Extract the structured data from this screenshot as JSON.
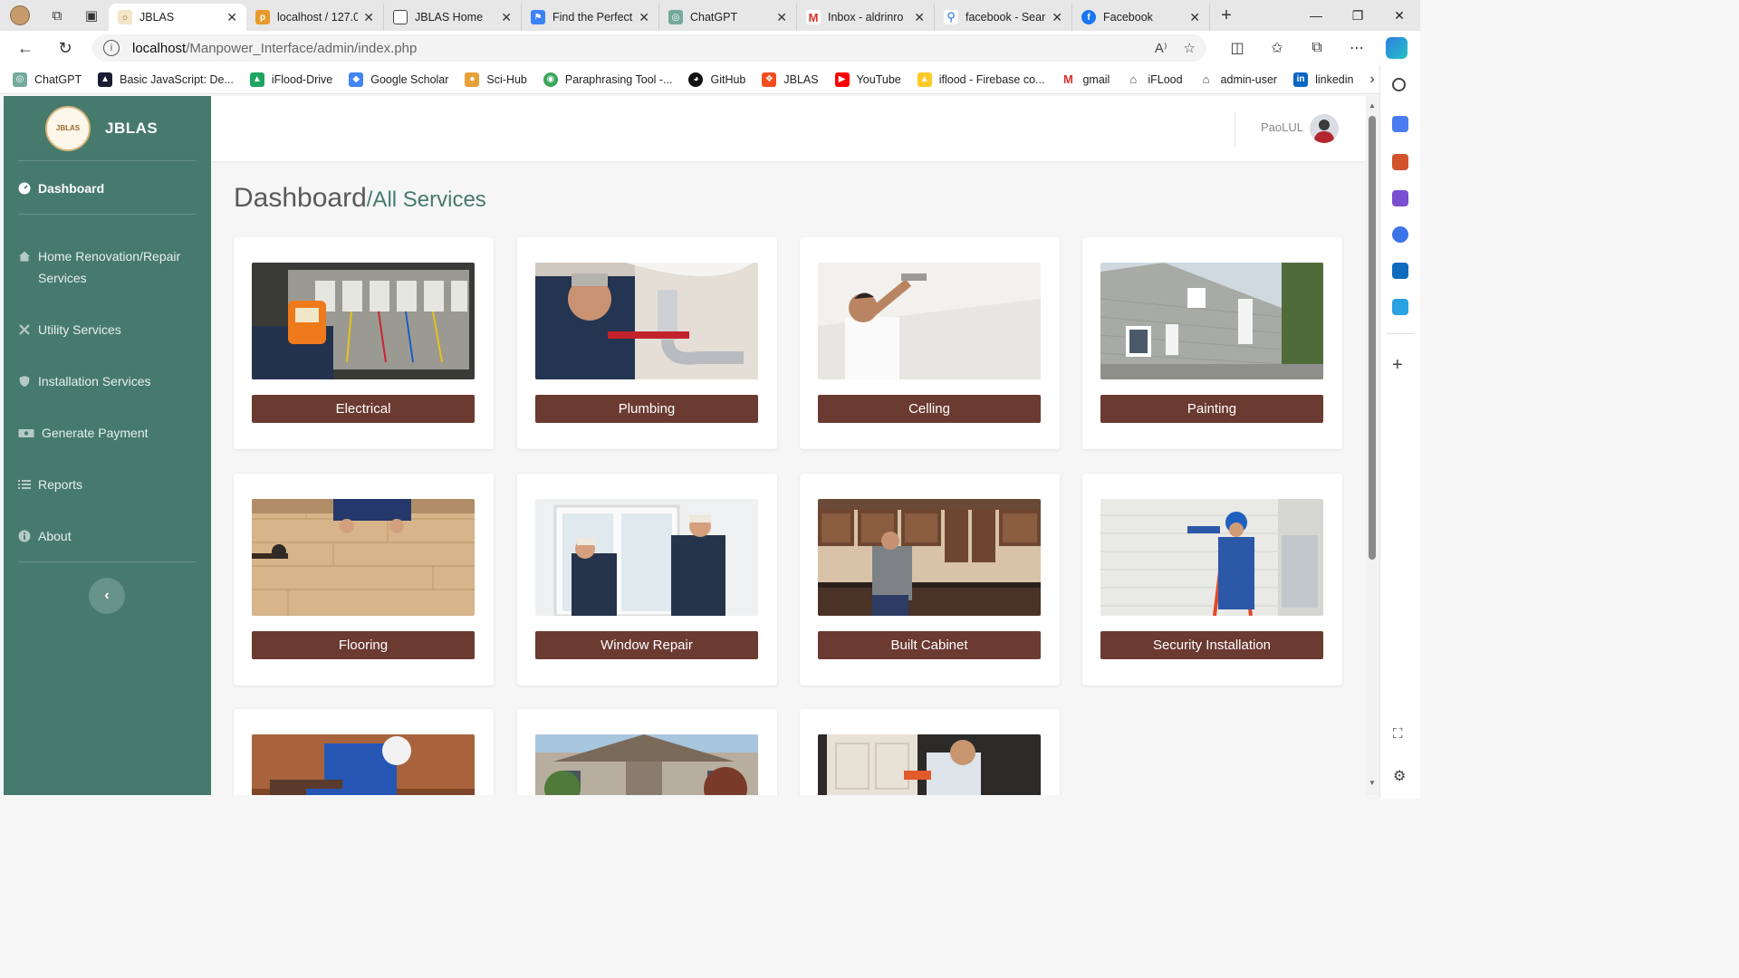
{
  "browser": {
    "tabs": [
      {
        "label": "JBLAS",
        "active": true
      },
      {
        "label": "localhost / 127.0",
        "active": false
      },
      {
        "label": "JBLAS Home",
        "active": false
      },
      {
        "label": "Find the Perfect",
        "active": false
      },
      {
        "label": "ChatGPT",
        "active": false
      },
      {
        "label": "Inbox - aldrinro",
        "active": false
      },
      {
        "label": "facebook - Searc",
        "active": false
      },
      {
        "label": "Facebook",
        "active": false
      }
    ],
    "url_host": "localhost",
    "url_path": "/Manpower_Interface/admin/index.php",
    "bookmarks": [
      "ChatGPT",
      "Basic JavaScript: De...",
      "iFlood-Drive",
      "Google Scholar",
      "Sci-Hub",
      "Paraphrasing Tool -...",
      "GitHub",
      "JBLAS",
      "YouTube",
      "iflood - Firebase co...",
      "gmail",
      "iFLood",
      "admin-user",
      "linkedin"
    ]
  },
  "app": {
    "brand": "JBLAS",
    "logo_text": "JBLAS",
    "user_name": "PaoLUL",
    "page_title": "Dashboard",
    "page_subtitle": "/All Services",
    "nav": [
      {
        "label": "Dashboard",
        "icon": "dashboard-icon",
        "active": true
      },
      {
        "label": "Home Renovation/Repair Services",
        "icon": "home-icon",
        "active": false
      },
      {
        "label": "Utility Services",
        "icon": "tools-icon",
        "active": false
      },
      {
        "label": "Installation Services",
        "icon": "shield-icon",
        "active": false
      },
      {
        "label": "Generate Payment",
        "icon": "money-icon",
        "active": false
      },
      {
        "label": "Reports",
        "icon": "list-icon",
        "active": false
      },
      {
        "label": "About",
        "icon": "info-icon",
        "active": false
      }
    ],
    "collapse_icon": "‹",
    "services": [
      {
        "label": "Electrical",
        "photo": "electrical-photo"
      },
      {
        "label": "Plumbing",
        "photo": "plumbing-photo"
      },
      {
        "label": "Celling",
        "photo": "ceiling-photo"
      },
      {
        "label": "Painting",
        "photo": "painting-photo"
      },
      {
        "label": "Flooring",
        "photo": "flooring-photo"
      },
      {
        "label": "Window Repair",
        "photo": "window-photo"
      },
      {
        "label": "Built Cabinet",
        "photo": "cabinet-photo"
      },
      {
        "label": "Security Installation",
        "photo": "security-photo"
      },
      {
        "label": "",
        "photo": "roofing-photo"
      },
      {
        "label": "",
        "photo": "house-photo"
      },
      {
        "label": "",
        "photo": "door-photo"
      }
    ]
  },
  "colors": {
    "sidebar": "#467a6d",
    "button": "#6b3a31",
    "subtitle": "#467a6d"
  }
}
